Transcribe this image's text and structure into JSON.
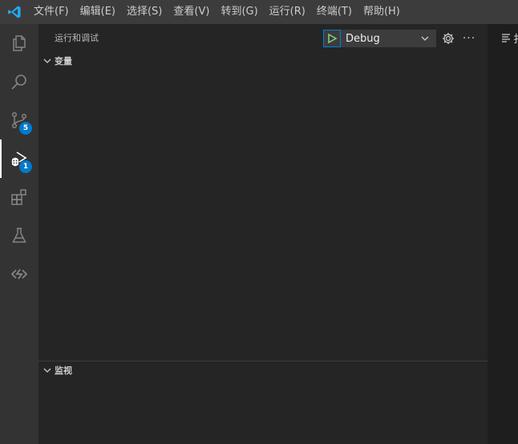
{
  "menu": {
    "items": [
      "文件(F)",
      "编辑(E)",
      "选择(S)",
      "查看(V)",
      "转到(G)",
      "运行(R)",
      "终端(T)",
      "帮助(H)"
    ]
  },
  "activity": {
    "scm_badge": "5",
    "debug_badge": "1"
  },
  "sidebar": {
    "title": "运行和调试",
    "config_label": "Debug",
    "sections": {
      "variables": "变量",
      "watch": "监视"
    }
  },
  "editor": {
    "tab_label": "扌"
  },
  "colors": {
    "accent": "#007acc",
    "run_green": "#89d185",
    "titlebar": "#3c3c3c",
    "activitybar": "#333333",
    "sidebar": "#252526"
  }
}
